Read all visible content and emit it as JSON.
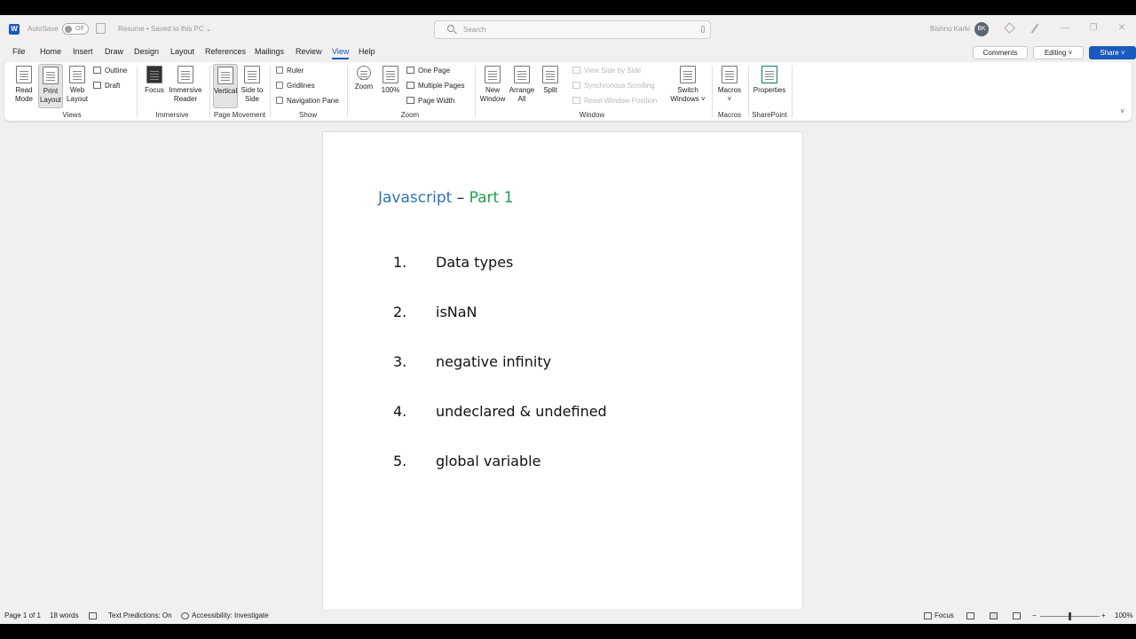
{
  "titlebar": {
    "autosave_label": "AutoSave",
    "autosave_state": "Off",
    "doc_title": "Resume • Saved to this PC ⌄",
    "search_placeholder": "Search",
    "user_name": "Bishnu Karki",
    "user_initials": "BK",
    "minimize": "—",
    "maximize": "❐",
    "close": "✕"
  },
  "menu": {
    "tabs": [
      "File",
      "Home",
      "Insert",
      "Draw",
      "Design",
      "Layout",
      "References",
      "Mailings",
      "Review",
      "View",
      "Help"
    ],
    "active_tab": "View",
    "comments_label": "Comments",
    "editing_label": "Editing ˅",
    "share_label": "Share ˅"
  },
  "ribbon": {
    "views": {
      "read_mode": "Read Mode",
      "print_layout": "Print Layout",
      "web_layout": "Web Layout",
      "outline": "Outline",
      "draft": "Draft",
      "label": "Views"
    },
    "immersive": {
      "focus": "Focus",
      "immersive_reader": "Immersive Reader",
      "label": "Immersive"
    },
    "page_movement": {
      "vertical": "Vertical",
      "side_to_side": "Side to Side",
      "label": "Page Movement"
    },
    "show": {
      "ruler": "Ruler",
      "gridlines": "Gridlines",
      "navigation_pane": "Navigation Pane",
      "label": "Show"
    },
    "zoom": {
      "zoom": "Zoom",
      "hundred": "100%",
      "one_page": "One Page",
      "multiple_pages": "Multiple Pages",
      "page_width": "Page Width",
      "label": "Zoom"
    },
    "window": {
      "new_window": "New Window",
      "arrange_all": "Arrange All",
      "split": "Split",
      "view_side_by_side": "View Side by Side",
      "synchronous_scrolling": "Synchronous Scrolling",
      "reset_window_position": "Reset Window Position",
      "switch_windows": "Switch Windows ˅",
      "label": "Window"
    },
    "macros": {
      "macros": "Macros ˅",
      "label": "Macros"
    },
    "sharepoint": {
      "properties": "Properties",
      "label": "SharePoint"
    },
    "collapse": "˅"
  },
  "document": {
    "heading_js": "Javascript",
    "heading_dash": " – ",
    "heading_part": "Part 1",
    "items": [
      {
        "num": "1.",
        "text": "Data types"
      },
      {
        "num": "2.",
        "text": "isNaN"
      },
      {
        "num": "3.",
        "text": "negative infinity"
      },
      {
        "num": "4.",
        "text": "undeclared & undefined"
      },
      {
        "num": "5.",
        "text": "global variable"
      }
    ]
  },
  "statusbar": {
    "page": "Page 1 of 1",
    "words": "18 words",
    "text_predictions": "Text Predictions: On",
    "accessibility": "Accessibility: Investigate",
    "focus": "Focus",
    "zoom_minus": "−",
    "zoom_plus": "+",
    "zoom_level": "100%"
  },
  "colors": {
    "accent": "#185abd",
    "heading_blue": "#2e74b5",
    "heading_green": "#1aa34a"
  }
}
